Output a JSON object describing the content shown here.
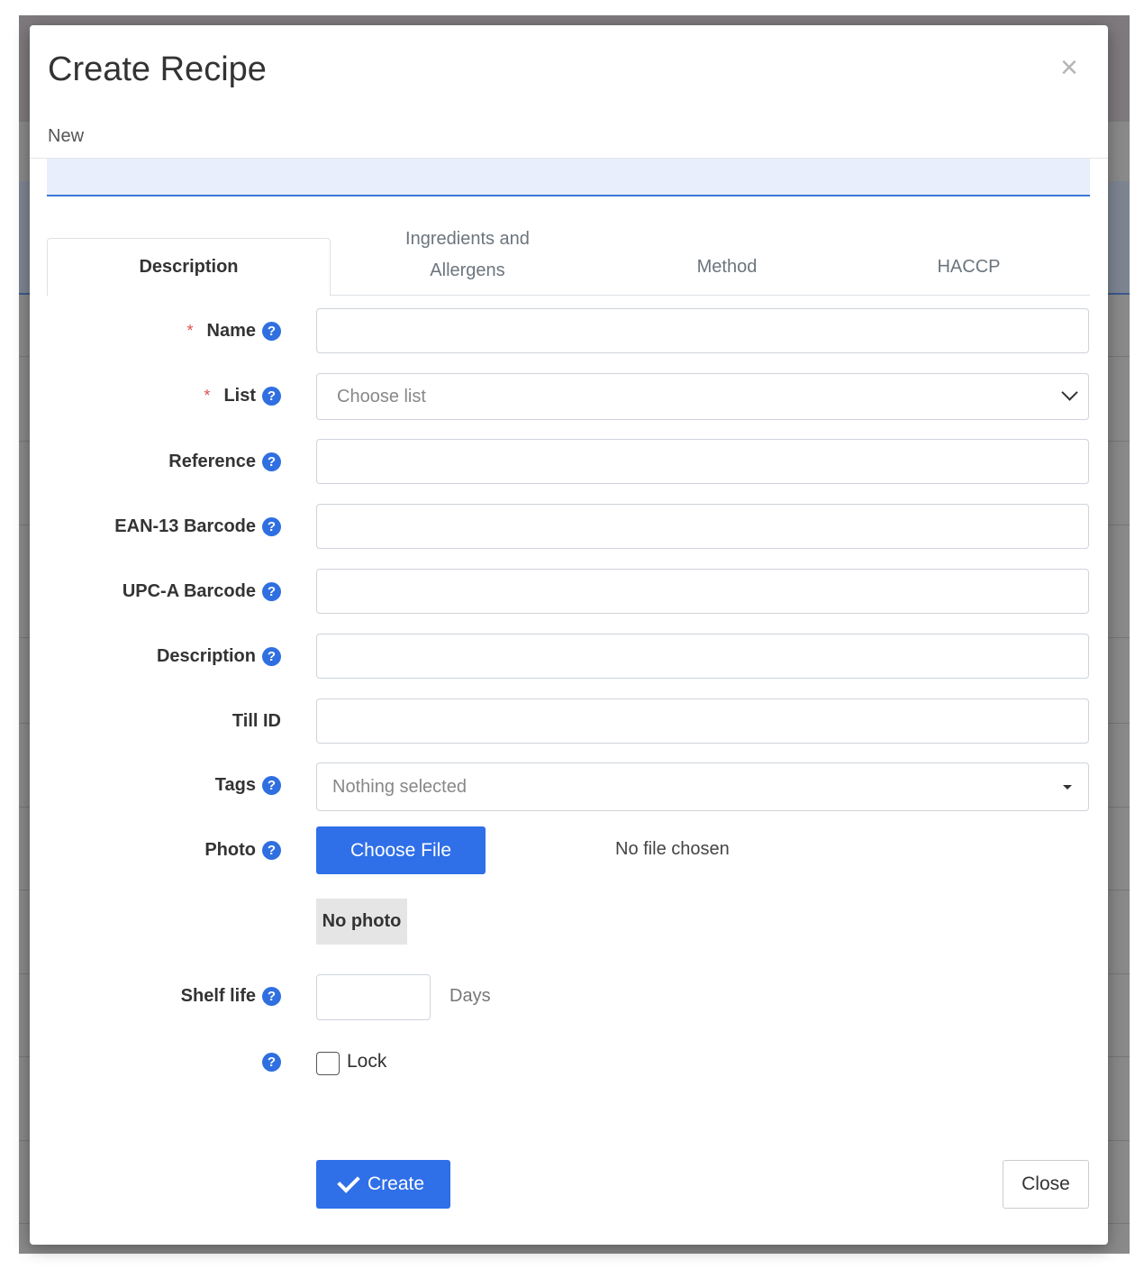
{
  "modal": {
    "title": "Create Recipe",
    "close_symbol": "×",
    "subtitle": "New"
  },
  "tabs": [
    {
      "label": "Description",
      "active": true
    },
    {
      "label": "Ingredients and Allergens",
      "line1": "Ingredients and",
      "line2": "Allergens",
      "active": false
    },
    {
      "label": "Method",
      "active": false
    },
    {
      "label": "HACCP",
      "active": false
    }
  ],
  "form": {
    "help_symbol": "?",
    "required_symbol": "*",
    "name": {
      "label": "Name",
      "value": ""
    },
    "list": {
      "label": "List",
      "placeholder": "Choose list"
    },
    "reference": {
      "label": "Reference",
      "value": ""
    },
    "ean13": {
      "label": "EAN-13 Barcode",
      "value": ""
    },
    "upca": {
      "label": "UPC-A Barcode",
      "value": ""
    },
    "description": {
      "label": "Description",
      "value": ""
    },
    "till_id": {
      "label": "Till ID",
      "value": ""
    },
    "tags": {
      "label": "Tags",
      "placeholder": "Nothing selected"
    },
    "photo": {
      "label": "Photo",
      "button": "Choose File",
      "status": "No file chosen",
      "preview": "No photo"
    },
    "shelf_life": {
      "label": "Shelf life",
      "value": "",
      "unit": "Days"
    },
    "lock": {
      "label": "Lock",
      "checked": false
    }
  },
  "footer": {
    "create_label": "Create",
    "close_label": "Close"
  },
  "colors": {
    "primary": "#2f6fe8",
    "help_icon": "#2f6fe0",
    "required": "#d9534f",
    "info_bar": "#e8eefb"
  }
}
